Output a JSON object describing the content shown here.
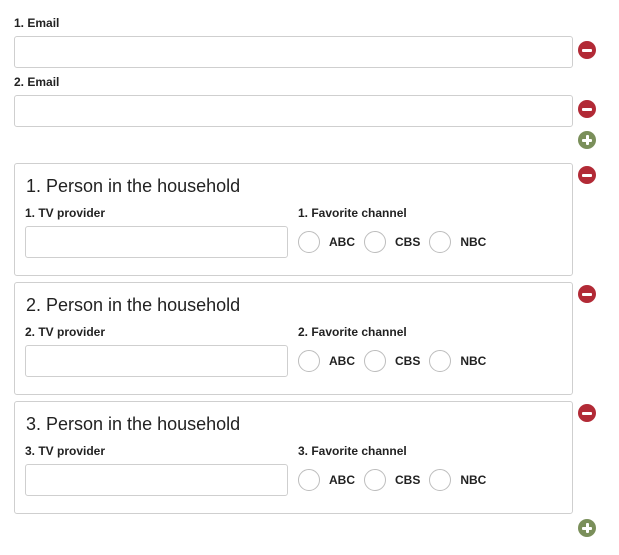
{
  "emails": [
    {
      "label": "1. Email",
      "value": ""
    },
    {
      "label": "2. Email",
      "value": ""
    }
  ],
  "household": [
    {
      "title": "1. Person in the household",
      "provider_label": "1. TV provider",
      "provider_value": "",
      "channel_label": "1. Favorite channel",
      "options": [
        "ABC",
        "CBS",
        "NBC"
      ]
    },
    {
      "title": "2. Person in the household",
      "provider_label": "2. TV provider",
      "provider_value": "",
      "channel_label": "2. Favorite channel",
      "options": [
        "ABC",
        "CBS",
        "NBC"
      ]
    },
    {
      "title": "3. Person in the household",
      "provider_label": "3. TV provider",
      "provider_value": "",
      "channel_label": "3. Favorite channel",
      "options": [
        "ABC",
        "CBS",
        "NBC"
      ]
    }
  ],
  "icons": {
    "remove": "minus-circle-icon",
    "add": "plus-circle-icon"
  },
  "colors": {
    "remove": "#b22a36",
    "add": "#7a8f5a",
    "border": "#cfcfcf"
  }
}
